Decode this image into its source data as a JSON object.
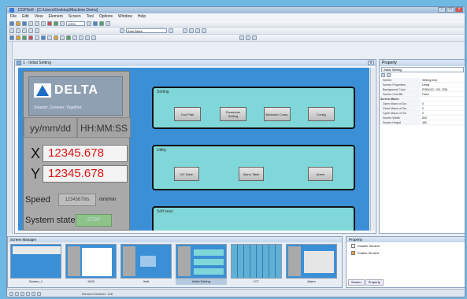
{
  "window": {
    "title": "DOPSoft - [C:\\Users\\Desktop\\Machine Demo]"
  },
  "menu": [
    "File",
    "Edit",
    "View",
    "Element",
    "Screen",
    "Tool",
    "Options",
    "Window",
    "Help"
  ],
  "toolbar": {
    "zoom": "100%",
    "font_combo": "Arial Black"
  },
  "editor": {
    "title": "1 - Initial Setting",
    "close": "x"
  },
  "hmi": {
    "logo": "DELTA",
    "logo_tag": "Smarter. Greener. Together.",
    "date": "yy/mm/dd",
    "time": "HH:MM:SS",
    "x_label": "X",
    "x_value": "12345.678",
    "y_label": "Y",
    "y_value": "12345.678",
    "speed_label": "Speed",
    "speed_value": "12345678/s",
    "speed_unit": "mm/min",
    "state_label": "System state",
    "state_value": "STOP",
    "groups": [
      {
        "label": "Setting",
        "buttons": [
          "Tool Path",
          "Parameter Setting",
          "Backlash Comp.",
          "Config"
        ]
      },
      {
        "label": "Utility",
        "buttons": [
          "I/O Table",
          "Alarm Table",
          "Alarm"
        ]
      },
      {
        "label": "Soft keys",
        "buttons": []
      }
    ]
  },
  "properties": {
    "title": "Property",
    "object": "Initial Setting",
    "rows": [
      {
        "k": "Screen",
        "v": "Setting.bmp"
      },
      {
        "k": "Screen Properties",
        "v": "Detail"
      },
      {
        "k": "Background Color",
        "v": "RGB(102, 153, 255)"
      },
      {
        "k": "Screen Cont Bit",
        "v": "False"
      },
      {
        "k": "Screen Macro",
        "v": "",
        "section": true
      },
      {
        "k": "Open Macro of Scr",
        "v": "0"
      },
      {
        "k": "Close Macro of Scr",
        "v": "0"
      },
      {
        "k": "Cycle Macro of Scr",
        "v": "0"
      },
      {
        "k": "Screen Width",
        "v": "800"
      },
      {
        "k": "Screen Height",
        "v": "480"
      }
    ]
  },
  "screen_manager": {
    "title": "Screen Manager",
    "items": [
      "Screen_1",
      "1000",
      "limit",
      "Initial Setting",
      "ICT",
      "Alarm"
    ],
    "selected": 3
  },
  "state_panel": {
    "title": "Property",
    "items": [
      "Disable Student",
      "Enable Student"
    ],
    "tabs": [
      "Screen",
      "Property"
    ]
  },
  "statusbar": {
    "text": "Element Number: 128"
  }
}
